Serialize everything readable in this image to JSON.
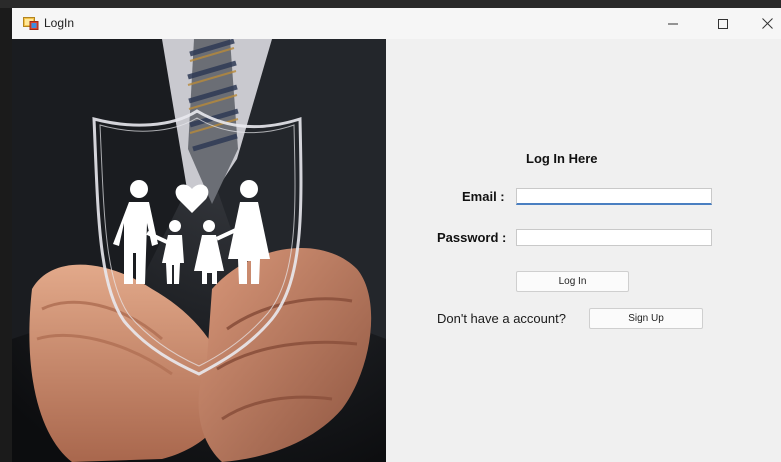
{
  "window": {
    "title": "LogIn",
    "minimize_icon": "minimize-icon",
    "maximize_icon": "maximize-icon",
    "close_icon": "close-icon"
  },
  "image": {
    "description_icon": "family-insurance-shield-icon"
  },
  "form": {
    "heading": "Log In Here",
    "email_label": "Email :",
    "email_value": "",
    "password_label": "Password :",
    "password_value": "",
    "login_button": "Log In",
    "no_account_text": "Don't have a account?",
    "signup_button": "Sign Up"
  },
  "colors": {
    "form_background": "#f0f0f0",
    "focus_underline": "#4a7fc1"
  }
}
